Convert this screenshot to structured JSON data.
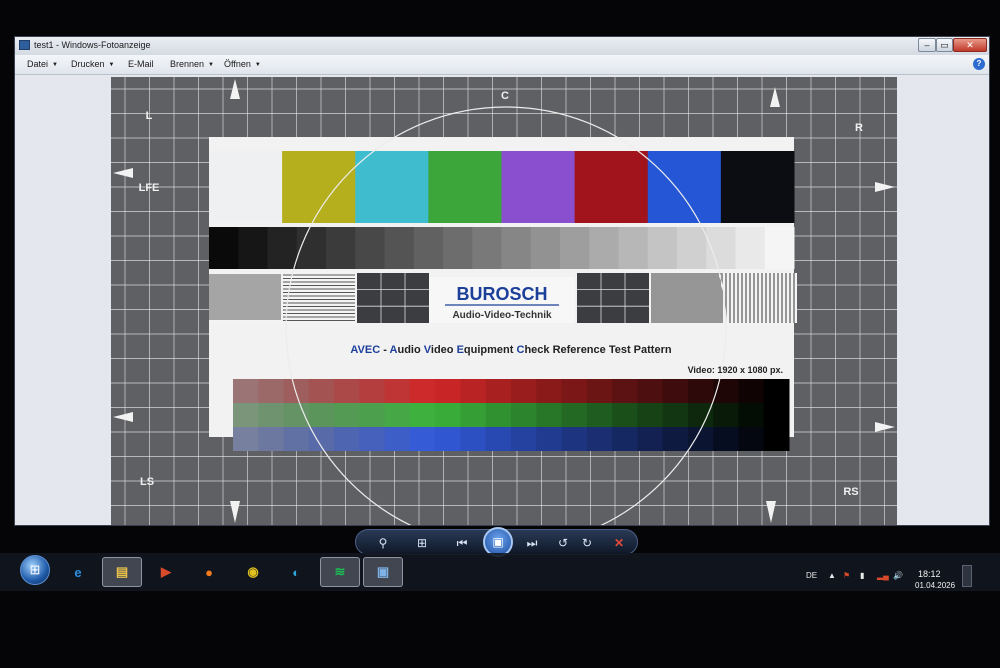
{
  "window": {
    "title": "test1 - Windows-Fotoanzeige",
    "min_glyph": "–",
    "max_glyph": "▭",
    "close_glyph": "✕"
  },
  "menubar": {
    "items": [
      {
        "label": "Datei",
        "has_dropdown": true
      },
      {
        "label": "Drucken",
        "has_dropdown": true
      },
      {
        "label": "E-Mail",
        "has_dropdown": false
      },
      {
        "label": "Brennen",
        "has_dropdown": true
      },
      {
        "label": "Öffnen",
        "has_dropdown": true
      }
    ],
    "help_glyph": "?"
  },
  "pattern": {
    "corner_labels": {
      "top_left": "L",
      "top_center": "C",
      "top_right": "R",
      "left_mid": "LFE",
      "bottom_left": "LS",
      "bottom_right": "RS"
    },
    "logo_text": "BUROSCH",
    "logo_subtitle": "Audio-Video-Technik",
    "headline_parts": [
      "AVEC",
      " - ",
      "A",
      "udio ",
      "V",
      "ideo ",
      "E",
      "quipment ",
      "C",
      "heck Reference Test Pattern"
    ],
    "video_resolution": "Video: 1920 x 1080 px.",
    "color_bars": [
      "#eef0f2",
      "#b5ae1d",
      "#3fbdcf",
      "#3ca63a",
      "#8a4fcf",
      "#a2141b",
      "#2456d6",
      "#0b0d12"
    ],
    "gray_steps": 20,
    "accent_blue": "#1c3f9a",
    "grid_color": "#5f6063",
    "line_color": "#e8e8e8"
  },
  "viewer_toolbar": {
    "zoom_icon": "⚲",
    "actual_size_icon": "⊞",
    "prev_icon": "⏮",
    "slideshow_icon": "▣",
    "next_icon": "⏭",
    "rotate_ccw_icon": "↺",
    "rotate_cw_icon": "↻",
    "delete_icon": "✕"
  },
  "taskbar": {
    "start_glyph": "⊞",
    "apps": [
      {
        "name": "ie-icon",
        "glyph": "e",
        "color": "#2b8de0",
        "active": false
      },
      {
        "name": "explorer-icon",
        "glyph": "▤",
        "color": "#e8c14a",
        "active": true
      },
      {
        "name": "media-player-icon",
        "glyph": "▶",
        "color": "#d84a2a",
        "active": false
      },
      {
        "name": "firefox-icon",
        "glyph": "●",
        "color": "#f07a1c",
        "active": false
      },
      {
        "name": "chrome-icon",
        "glyph": "◉",
        "color": "#e0c120",
        "active": false
      },
      {
        "name": "edge-icon",
        "glyph": "◐",
        "color": "#2fa4d8",
        "active": false
      },
      {
        "name": "spotify-icon",
        "glyph": "≋",
        "color": "#1db954",
        "active": true
      },
      {
        "name": "photo-viewer-icon",
        "glyph": "▣",
        "color": "#7fb2e8",
        "active": true
      }
    ],
    "language": "DE",
    "tray_up": "▲",
    "clock_time": "18:12",
    "clock_date": "01.04.2026"
  }
}
